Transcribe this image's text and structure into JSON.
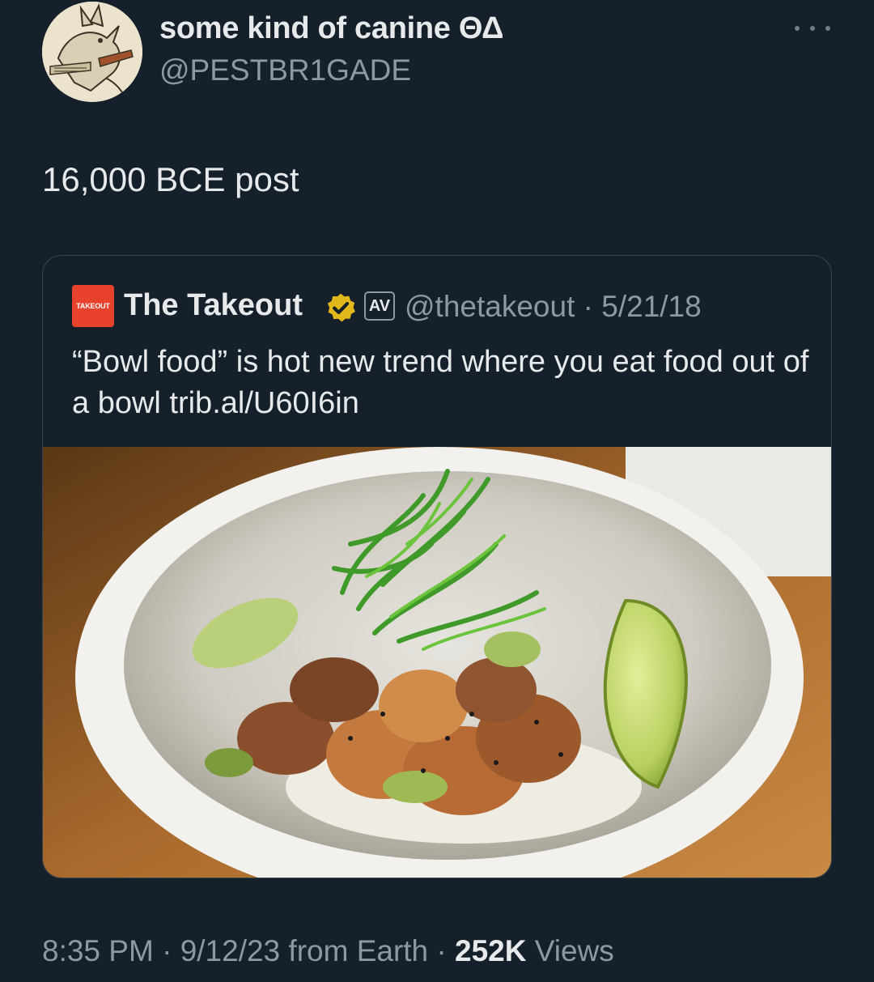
{
  "author": {
    "display_name": "some kind of canine ΘΔ",
    "handle": "@PESTBR1GADE",
    "avatar": "medieval-rabbit-drawing"
  },
  "tweet": {
    "text": "16,000 BCE post"
  },
  "quoted": {
    "logo_text": "TAKEOUT",
    "name": "The Takeout",
    "badge": "verified-gold-icon",
    "affiliate": "AV",
    "handle": "@thetakeout",
    "separator": "·",
    "date": "5/21/18",
    "text": "“Bowl food” is hot new trend where you eat food out of a bowl trib.al/U60I6in",
    "image": "poke-bowl-with-seaweed-and-lime-photo"
  },
  "meta": {
    "time": "8:35 PM",
    "separator": "·",
    "date": "9/12/23",
    "source": "from Earth",
    "views_count": "252K",
    "views_label": "Views"
  },
  "colors": {
    "background": "#15202b",
    "text": "#e7e9ea",
    "secondary": "#8b98a5",
    "border": "#38444d",
    "logo": "#e8412c",
    "verified": "#e2b719"
  }
}
